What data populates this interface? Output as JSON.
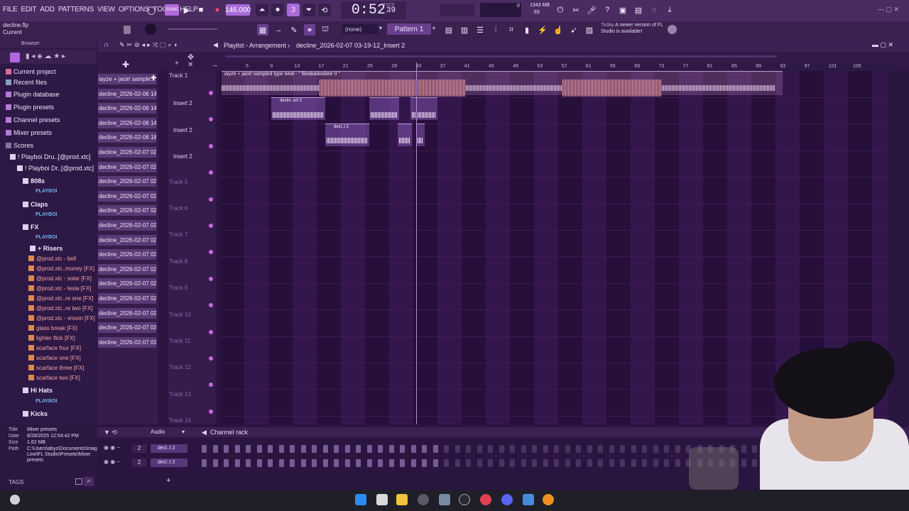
{
  "menu": [
    "FILE",
    "EDIT",
    "ADD",
    "PATTERNS",
    "VIEW",
    "OPTIONS",
    "TOOLS",
    "HELP"
  ],
  "transport": {
    "tempo": "146.000",
    "time": "0:52",
    "time_small": "39",
    "time_label": "M:S:CS",
    "song_label": "SONG",
    "mem": "1343 MB",
    "cpu": "83",
    "cpu_zero": "0"
  },
  "project": {
    "filename": "decline.flp",
    "status": "Current"
  },
  "toolbar2": {
    "pattern_none": "(none)",
    "pattern": "Pattern 1",
    "news_date": "Today",
    "news_text": "A newer version of FL Studio is available!"
  },
  "browser": {
    "header": "Browser",
    "items": [
      {
        "label": "Current project",
        "kind": "folder"
      },
      {
        "label": "Recent files",
        "kind": "folder"
      },
      {
        "label": "Plugin database",
        "kind": "folder"
      },
      {
        "label": "Plugin presets",
        "kind": "folder"
      },
      {
        "label": "Channel presets",
        "kind": "folder"
      },
      {
        "label": "Mixer presets",
        "kind": "folder"
      },
      {
        "label": "Scores",
        "kind": "folder"
      },
      {
        "label": "! Playboi Dru..[@prod.xtc]",
        "kind": "folder"
      },
      {
        "label": "! Playboi Dr..[@prod.xtc]",
        "kind": "folder"
      },
      {
        "label": "808s",
        "kind": "folder"
      },
      {
        "label": "Claps",
        "kind": "folder"
      },
      {
        "label": "FX",
        "kind": "folder"
      },
      {
        "label": "+ Risers",
        "kind": "folder"
      },
      {
        "label": "@prod.xtc - bell",
        "kind": "file"
      },
      {
        "label": "@prod.xtc..money [FX]",
        "kind": "file"
      },
      {
        "label": "@prod.xtc - solar [FX]",
        "kind": "file"
      },
      {
        "label": "@prod.xtc - tesla [FX]",
        "kind": "file"
      },
      {
        "label": "@prod.xtc..re one [FX]",
        "kind": "file"
      },
      {
        "label": "@prod.xtc..re two [FX]",
        "kind": "file"
      },
      {
        "label": "@prod.xtc - vroom [FX]",
        "kind": "file"
      },
      {
        "label": "glass break [FX]",
        "kind": "file"
      },
      {
        "label": "lighter flick [FX]",
        "kind": "file"
      },
      {
        "label": "scarface four [FX]",
        "kind": "file"
      },
      {
        "label": "scarface one [FX]",
        "kind": "file"
      },
      {
        "label": "scarface three [FX]",
        "kind": "file"
      },
      {
        "label": "scarface two [FX]",
        "kind": "file"
      },
      {
        "label": "Hi Hats",
        "kind": "folder"
      },
      {
        "label": "Kicks",
        "kind": "folder"
      }
    ],
    "brand_text": "PLAYBOI",
    "info": {
      "title_k": "Title",
      "title_v": "Mixer presets",
      "date_k": "Date",
      "date_v": "8/28/2025 12:54:42 PM",
      "size_k": "Size",
      "size_v": "1.62 MB",
      "path_k": "Path",
      "path_v": "C:\\Users\\abys\\Documents\\Image-Line\\FL Studio\\Presets\\Mixer presets",
      "tags": "TAGS"
    }
  },
  "playlist": {
    "title": "Playlist - Arrangement",
    "arrangement": "decline_2026-02-07 03-19-12_Insert 2",
    "ruler": [
      "5",
      "9",
      "13",
      "17",
      "21",
      "25",
      "29",
      "33",
      "37",
      "41",
      "45",
      "49",
      "53",
      "57",
      "61",
      "65",
      "69",
      "73",
      "77",
      "81",
      "85",
      "89",
      "93",
      "97",
      "101",
      "105"
    ],
    "clips": [
      "iayze + jace! sample...",
      "decline_2026-02-06 14-...",
      "decline_2026-02-06 14-...",
      "decline_2026-02-06 14-...",
      "decline_2026-02-06 18-...",
      "decline_2026-02-07 02-...",
      "decline_2026-02-07 02-...",
      "decline_2026-02-07 02-...",
      "decline_2026-02-07 02-...",
      "decline_2026-02-07 02-...",
      "decline_2026-02-07 02-...",
      "decline_2026-02-07 02-...",
      "decline_2026-02-07 02-...",
      "decline_2026-02-07 02-...",
      "decline_2026-02-07 02-...",
      "decline_2026-02-07 02-...",
      "decline_2026-02-07 02-...",
      "decline_2026-02-07 03-...",
      "decline_2026-02-07 03-..."
    ],
    "tracks": [
      "Track 1",
      "Insert 2",
      "Insert 2",
      "Insert 2",
      "Track 5",
      "Track 6",
      "Track 7",
      "Track 8",
      "Track 9",
      "Track 10",
      "Track 11",
      "Track 12",
      "Track 13",
      "Track 14"
    ],
    "main_clip_label": "iayze + jace! sampled type beat - \" Beabadoobee II \"",
    "insert_clip_label": "declin..ert 2",
    "small_clip_label": "decl..t 2"
  },
  "rack": {
    "filter": "Audio",
    "title": "Channel rack",
    "rows": [
      {
        "num": "2",
        "name": "decl..t 2"
      },
      {
        "num": "2",
        "name": "decl..t 2"
      }
    ],
    "add": "+"
  }
}
